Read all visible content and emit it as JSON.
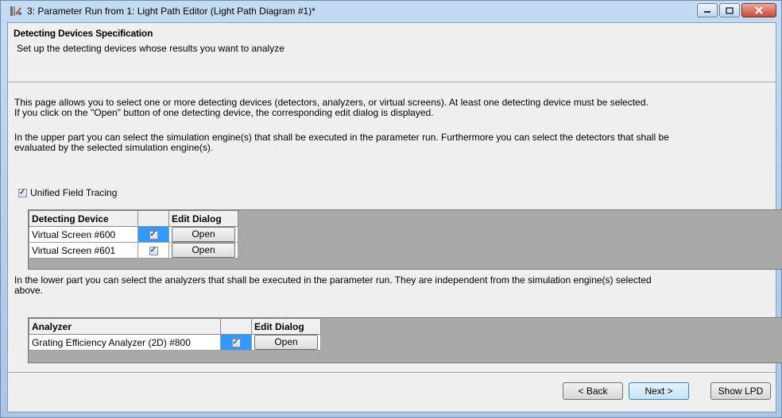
{
  "window": {
    "title": "3: Parameter Run from 1: Light Path Editor (Light Path Diagram #1)*",
    "buttons": [
      "minimize",
      "maximize",
      "close"
    ]
  },
  "header": {
    "title": "Detecting Devices Specification",
    "subtitle": "Set up the detecting devices whose results you want to analyze"
  },
  "description": {
    "para1_line1": "This page allows you to select one or more detecting devices (detectors, analyzers, or virtual screens). At least one detecting device must be selected.",
    "para1_line2": "If you click on the \"Open\" button of one detecting device, the corresponding edit dialog is displayed.",
    "para2_line1": "In the upper part you can select the simulation engine(s) that shall be executed in the parameter run. Furthermore you can select the detectors that shall be",
    "para2_line2": "evaluated by the selected simulation engine(s).",
    "para3_line1": "In the lower part you can select the analyzers that shall be executed in the parameter run. They are independent from the simulation engine(s) selected",
    "para3_line2": "above."
  },
  "unified_field_tracing": {
    "label": "Unified Field Tracing",
    "checked": true
  },
  "detectors_table": {
    "columns": [
      "Detecting Device",
      "",
      "Edit Dialog"
    ],
    "rows": [
      {
        "name": "Virtual Screen #600",
        "checked": true,
        "selected": true,
        "button": "Open"
      },
      {
        "name": "Virtual Screen #601",
        "checked": true,
        "selected": false,
        "button": "Open"
      }
    ]
  },
  "analyzers_table": {
    "columns": [
      "Analyzer",
      "",
      "Edit Dialog"
    ],
    "rows": [
      {
        "name": "Grating Efficiency Analyzer (2D) #800",
        "checked": true,
        "selected": true,
        "button": "Open"
      }
    ]
  },
  "footer": {
    "back": "< Back",
    "next": "Next >",
    "show_lpd": "Show LPD"
  },
  "colors": {
    "selection": "#3399ff",
    "grid_background": "#a9a9a9",
    "dialog_background": "#f0f0f0"
  }
}
